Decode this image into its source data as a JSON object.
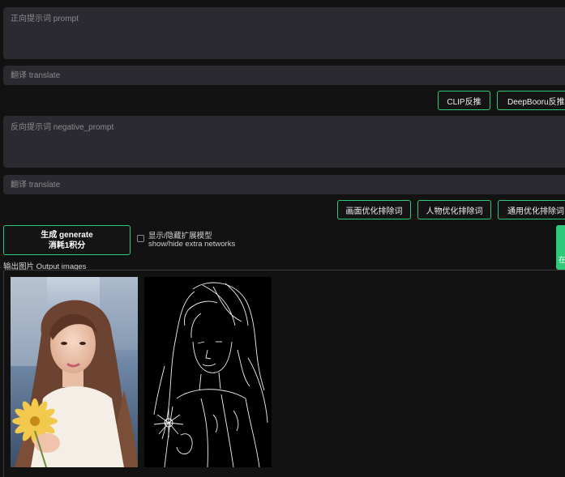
{
  "prompt": {
    "placeholder": "正向提示词 prompt",
    "value": ""
  },
  "translate_1": {
    "placeholder": "翻译 translate"
  },
  "interrogate": {
    "clip_label": "CLIP反推",
    "deepbooru_label": "DeepBooru反推"
  },
  "negative_prompt": {
    "placeholder": "反向提示词 negative_prompt",
    "value": ""
  },
  "translate_2": {
    "placeholder": "翻译 translate"
  },
  "negative_presets": {
    "scene_label": "画面优化排除词",
    "character_label": "人物优化排除词",
    "general_label": "通用优化排除词"
  },
  "generate": {
    "line1": "生成 generate",
    "line2": "消耗1积分"
  },
  "extra_networks": {
    "checked": false,
    "label_zh": "显示/隐藏扩展模型",
    "label_en": "show/hide extra networks"
  },
  "side_tab": {
    "label": "在"
  },
  "output": {
    "label": "输出图片 Output images",
    "images": [
      {
        "name": "photo",
        "icon": "portrait-photo"
      },
      {
        "name": "edge-map",
        "icon": "canny-edge-map"
      }
    ]
  },
  "colors": {
    "accent": "#2fc97a",
    "background": "#121212",
    "field": "#2a2a30",
    "text": "#e6e6e6",
    "placeholder": "#8a8a8f"
  }
}
